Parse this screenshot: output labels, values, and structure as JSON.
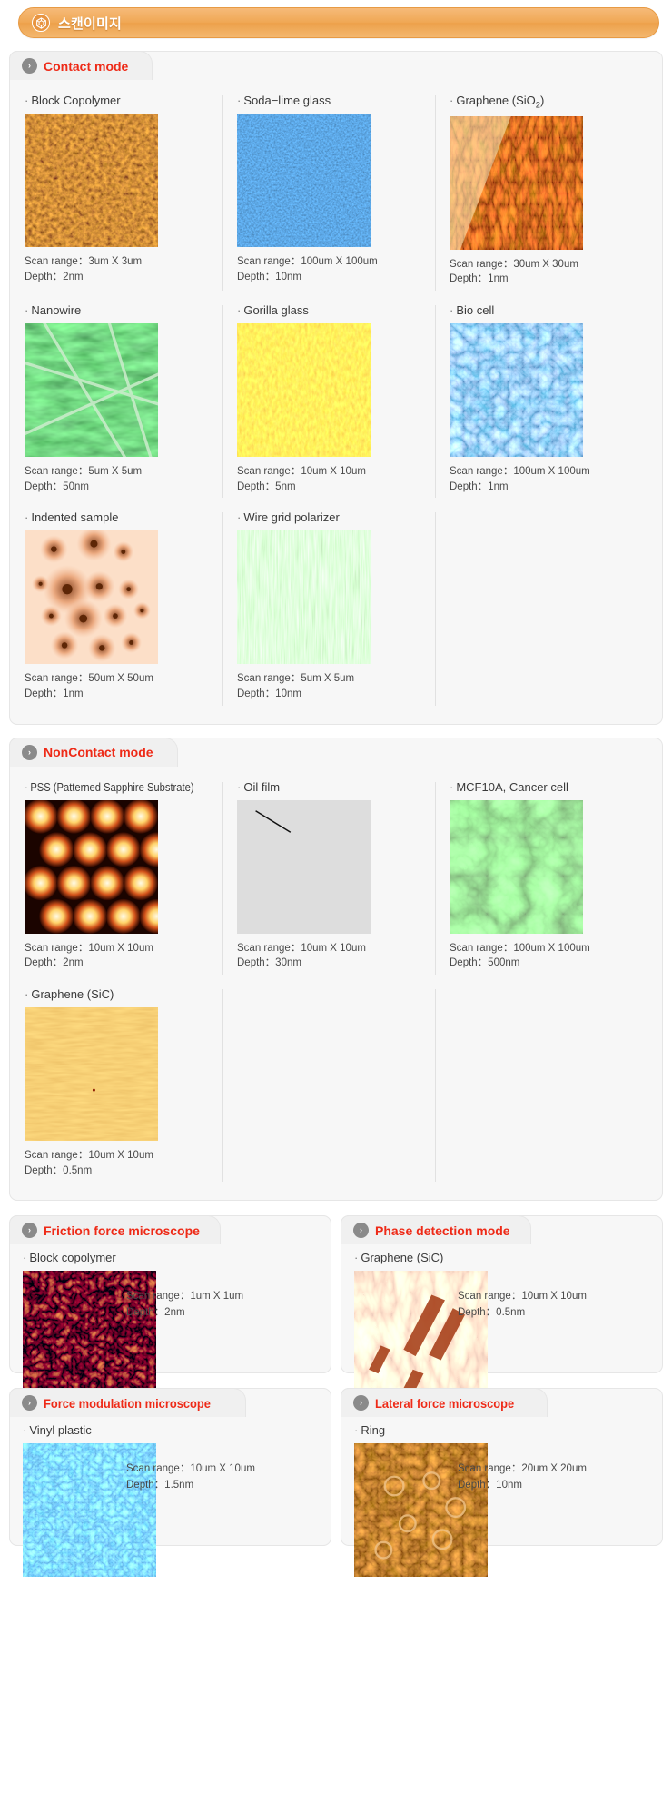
{
  "header": {
    "title": "스캔이미지",
    "icon": "hex-grid-icon",
    "accent_color": "#f0a855",
    "text_color": "#ffffff"
  },
  "labels": {
    "scan_range_prefix": "Scan range",
    "depth_prefix": "Depth",
    "separator": "：",
    "bullet": "·",
    "chevron": "›"
  },
  "sections": [
    {
      "id": "contact-mode",
      "title": "Contact mode",
      "title_color": "#ee2a17",
      "rows": [
        [
          {
            "name": "Block Copolymer",
            "scan_range": "Scan range：3um X 3um",
            "depth": "Depth：2nm",
            "image": "afm-block-copolymer"
          },
          {
            "name": "Soda−lime glass",
            "scan_range": "Scan range：100um X 100um",
            "depth": "Depth：10nm",
            "image": "afm-soda-lime-glass"
          },
          {
            "name": "Graphene (SiO2)",
            "name_base": "Graphene (SiO",
            "name_sub": "2",
            "name_tail": ")",
            "scan_range": "Scan range：30um X 30um",
            "depth": "Depth：1nm",
            "image": "afm-graphene-sio2"
          }
        ],
        [
          {
            "name": "Nanowire",
            "scan_range": "Scan range：5um X 5um",
            "depth": "Depth：50nm",
            "image": "afm-nanowire"
          },
          {
            "name": "Gorilla glass",
            "scan_range": "Scan range：10um X 10um",
            "depth": "Depth：5nm",
            "image": "afm-gorilla-glass"
          },
          {
            "name": "Bio cell",
            "scan_range": "Scan range：100um X 100um",
            "depth": "Depth：1nm",
            "image": "afm-bio-cell"
          }
        ],
        [
          {
            "name": "Indented sample",
            "scan_range": "Scan range：50um X 50um",
            "depth": "Depth：1nm",
            "image": "afm-indented-sample"
          },
          {
            "name": "Wire grid polarizer",
            "scan_range": "Scan range：5um X 5um",
            "depth": "Depth：10nm",
            "image": "afm-wire-grid-polarizer"
          },
          {
            "name": "",
            "scan_range": "",
            "depth": "",
            "image": ""
          }
        ]
      ]
    },
    {
      "id": "noncontact-mode",
      "title": "NonContact mode",
      "title_color": "#ee2a17",
      "rows": [
        [
          {
            "name": "PSS (Patterned Sapphire Substrate)",
            "condensed": true,
            "scan_range": "Scan range：10um X 10um",
            "depth": "Depth：2nm",
            "image": "afm-pss"
          },
          {
            "name": "Oil film",
            "scan_range": "Scan range：10um X 10um",
            "depth": "Depth：30nm",
            "image": "afm-oil-film"
          },
          {
            "name": "MCF10A, Cancer cell",
            "scan_range": "Scan range：100um X 100um",
            "depth": "Depth：500nm",
            "image": "afm-mcf10a-cancer-cell"
          }
        ],
        [
          {
            "name": "Graphene (SiC)",
            "scan_range": "Scan range：10um X 10um",
            "depth": "Depth：0.5nm",
            "image": "afm-graphene-sic"
          },
          {
            "name": "",
            "scan_range": "",
            "depth": "",
            "image": ""
          },
          {
            "name": "",
            "scan_range": "",
            "depth": "",
            "image": ""
          }
        ]
      ]
    }
  ],
  "panels": [
    {
      "id": "friction-force-microscope",
      "title": "Friction force microscope",
      "title_color": "#ee2a17",
      "sample": {
        "name": "Block copolymer",
        "scan_range": "Scan range：1um X 1um",
        "depth": "Depth：2nm",
        "image": "afm-block-copolymer-ffm"
      }
    },
    {
      "id": "phase-detection-mode",
      "title": "Phase detection mode",
      "title_color": "#ee2a17",
      "sample": {
        "name": "Graphene (SiC)",
        "scan_range": "Scan range：10um X 10um",
        "depth": "Depth：0.5nm",
        "image": "afm-graphene-sic-phase"
      }
    },
    {
      "id": "force-modulation-microscope",
      "title": "Force modulation microscope",
      "title_color": "#ee2a17",
      "condensed": true,
      "sample": {
        "name": "Vinyl plastic",
        "scan_range": "Scan range：10um X 10um",
        "depth": "Depth：1.5nm",
        "image": "afm-vinyl-plastic"
      }
    },
    {
      "id": "lateral-force-microscope",
      "title": "Lateral force microscope",
      "title_color": "#ee2a17",
      "condensed": true,
      "sample": {
        "name": "Ring",
        "scan_range": "Scan range：20um X 20um",
        "depth": "Depth：10nm",
        "image": "afm-ring"
      }
    }
  ]
}
